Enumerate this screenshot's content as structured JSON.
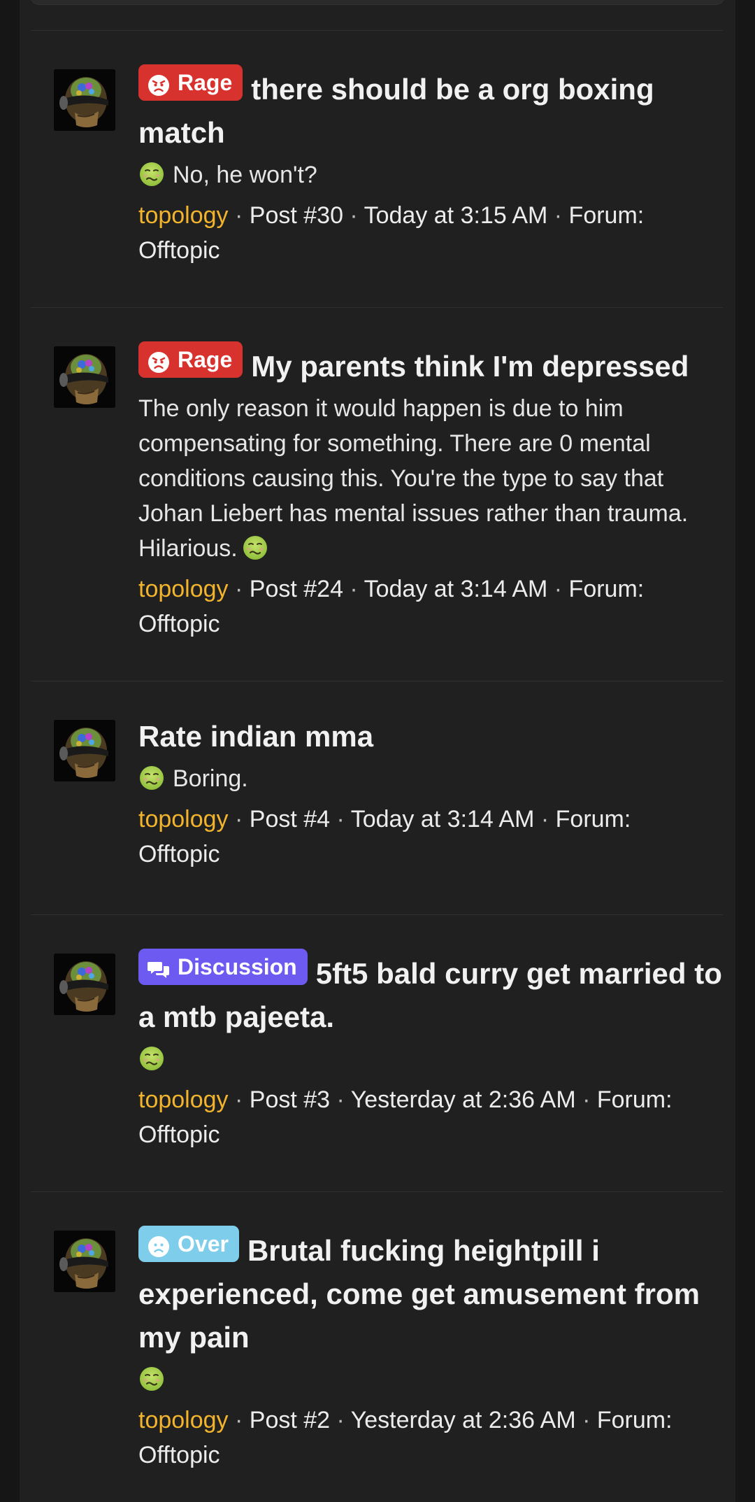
{
  "results": [
    {
      "badge": {
        "label": "Rage",
        "type": "rage",
        "icon": "angry-face-icon",
        "color": "#d8322f"
      },
      "title": "there should be a org boxing match",
      "snippet": "No, he won't?",
      "snippet_emoji": "nauseated-face-icon",
      "user": "topology",
      "post": "Post #30",
      "time": "Today at 3:15 AM",
      "forum_label": "Forum:",
      "forum": "Offtopic"
    },
    {
      "badge": {
        "label": "Rage",
        "type": "rage",
        "icon": "angry-face-icon",
        "color": "#d8322f"
      },
      "title": "My parents think I'm depressed",
      "snippet": "The only reason it would happen is due to him compensating for something. There are 0 mental conditions causing this. You're the type to say that Johan Liebert has mental issues rather than trauma. Hilarious.",
      "snippet_emoji": "nauseated-face-icon",
      "user": "topology",
      "post": "Post #24",
      "time": "Today at 3:14 AM",
      "forum_label": "Forum:",
      "forum": "Offtopic"
    },
    {
      "badge": null,
      "title": "Rate indian mma",
      "snippet": "Boring.",
      "snippet_emoji": "nauseated-face-icon",
      "user": "topology",
      "post": "Post #4",
      "time": "Today at 3:14 AM",
      "forum_label": "Forum:",
      "forum": "Offtopic"
    },
    {
      "badge": {
        "label": "Discussion",
        "type": "discussion",
        "icon": "chat-bubbles-icon",
        "color": "#6d5af0"
      },
      "title": "5ft5 bald curry get married to a mtb pajeeta.",
      "snippet": "",
      "snippet_emoji": "nauseated-face-icon",
      "user": "topology",
      "post": "Post #3",
      "time": "Yesterday at 2:36 AM",
      "forum_label": "Forum:",
      "forum": "Offtopic"
    },
    {
      "badge": {
        "label": "Over",
        "type": "over",
        "icon": "sad-face-icon",
        "color": "#7dcdeb"
      },
      "title": "Brutal fucking heightpill i experienced, come get amusement from my pain",
      "snippet": "",
      "snippet_emoji": "nauseated-face-icon",
      "user": "topology",
      "post": "Post #2",
      "time": "Yesterday at 2:36 AM",
      "forum_label": "Forum:",
      "forum": "Offtopic"
    }
  ],
  "colors": {
    "background": "#161616",
    "panel": "#202020",
    "username": "#f2b42d",
    "text": "#e9e9e9"
  }
}
